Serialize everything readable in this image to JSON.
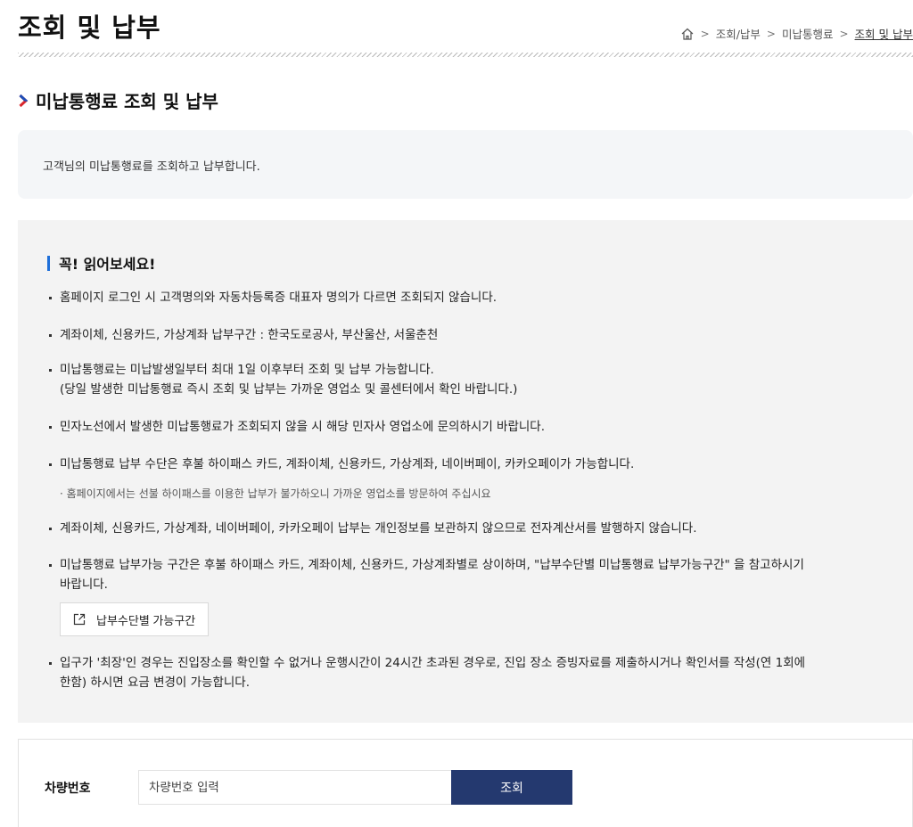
{
  "page": {
    "title": "조회 및 납부"
  },
  "breadcrumb": {
    "items": [
      "조회/납부",
      "미납통행료"
    ],
    "current": "조회 및 납부"
  },
  "section": {
    "title": "미납통행료 조회 및 납부"
  },
  "intro": {
    "text": "고객님의 미납통행료를 조회하고 납부합니다."
  },
  "notice": {
    "title": "꼭! 읽어보세요!",
    "items": [
      "홈페이지 로그인 시 고객명의와 자동차등록증 대표자 명의가 다르면 조회되지 않습니다.",
      "계좌이체, 신용카드, 가상계좌 납부구간 : 한국도로공사, 부산울산, 서울춘천",
      "미납통행료는 미납발생일부터 최대 1일 이후부터 조회 및 납부 가능합니다.",
      "(당일 발생한 미납통행료 즉시 조회 및 납부는 가까운 영업소 및 콜센터에서 확인 바랍니다.)",
      "민자노선에서 발생한 미납통행료가 조회되지 않을 시 해당 민자사 영업소에 문의하시기 바랍니다.",
      "미납통행료 납부 수단은 후불 하이패스 카드, 계좌이체, 신용카드, 가상계좌, 네이버페이, 카카오페이가 가능합니다.",
      "· 홈페이지에서는 선불 하이패스를 이용한 납부가 불가하오니 가까운 영업소를 방문하여 주십시요",
      "계좌이체, 신용카드, 가상계좌, 네이버페이, 카카오페이 납부는 개인정보를 보관하지 않으므로 전자계산서를 발행하지 않습니다.",
      "미납통행료 납부가능 구간은 후불 하이패스 카드, 계좌이체, 신용카드, 가상계좌별로 상이하며, \"납부수단별 미납통행료 납부가능구간\" 을 참고하시기",
      "바랍니다.",
      "입구가 '최장'인 경우는 진입장소를 확인할 수 없거나 운행시간이 24시간 초과된 경우로, 진입 장소 증빙자료를 제출하시거나 확인서를 작성(연 1회에",
      "한함) 하시면 요금 변경이 가능합니다."
    ],
    "link_label": "납부수단별 가능구간"
  },
  "search": {
    "label": "차량번호",
    "placeholder": "차량번호 입력",
    "button_label": "조회"
  },
  "colors": {
    "accent_blue": "#1e6fd9",
    "button_navy": "#24396f",
    "chevron_red": "#d9262c"
  },
  "icons": {
    "home": "home-icon",
    "chevron": "chevron-right-icon",
    "external": "external-link-icon"
  }
}
